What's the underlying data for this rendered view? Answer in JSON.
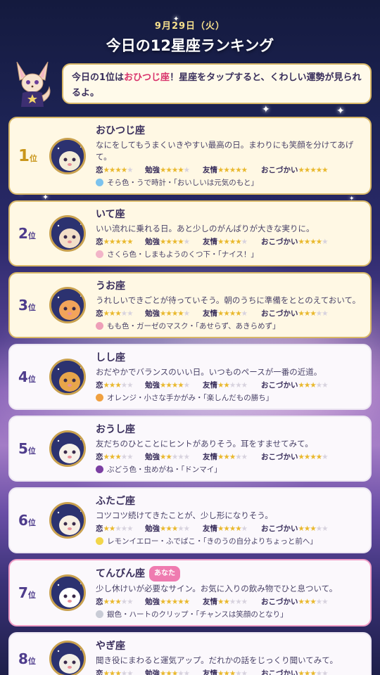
{
  "header": {
    "date": "9月29日（火）",
    "title": "今日の12星座ランキング"
  },
  "bubble": {
    "before": "今日の1位は",
    "highlight": "おひつじ座",
    "after": "！星座をタップすると、くわしい運勢が見られるよ。"
  },
  "labels": {
    "love": "恋",
    "study": "勉強",
    "friend": "友情",
    "money": "おこづかい",
    "rank_suffix": "位"
  },
  "colors": {
    "gold": "#c9961b",
    "star": "#e9b82c",
    "mine_border": "#ef9cc5"
  },
  "cards": [
    {
      "rank": "1",
      "name": "おひつじ座",
      "tag": "",
      "desc": "なにをしてもうまくいきやすい最高の日。まわりにも笑顔を分けてあげて。",
      "love": 4,
      "study": 4,
      "friend": 5,
      "money": 5,
      "lucky": "そら色・うで時計・「おいしいは元気のもと」",
      "dot": "#7cc3ee",
      "icon": "ram-icon"
    },
    {
      "rank": "2",
      "name": "いて座",
      "tag": "",
      "desc": "いい流れに乗れる日。あと少しのがんばりが大きな実りに。",
      "love": 5,
      "study": 4,
      "friend": 4,
      "money": 4,
      "lucky": "さくら色・しまもようのくつ下・「ナイス！」",
      "dot": "#f2b5c8",
      "icon": "archer-icon"
    },
    {
      "rank": "3",
      "name": "うお座",
      "tag": "",
      "desc": "うれしいできごとが待っていそう。朝のうちに準備をととのえておいて。",
      "love": 3,
      "study": 4,
      "friend": 4,
      "money": 3,
      "lucky": "もも色・ガーゼのマスク・「あせらず、あきらめず」",
      "dot": "#ee9fb8",
      "icon": "fish-icon"
    },
    {
      "rank": "4",
      "name": "しし座",
      "tag": "",
      "desc": "おだやかでバランスのいい日。いつものペースが一番の近道。",
      "love": 3,
      "study": 4,
      "friend": 2,
      "money": 3,
      "lucky": "オレンジ・小さな手かがみ・「楽しんだもの勝ち」",
      "dot": "#f0a040",
      "icon": "lion-icon"
    },
    {
      "rank": "5",
      "name": "おうし座",
      "tag": "",
      "desc": "友だちのひとことにヒントがありそう。耳をすませてみて。",
      "love": 3,
      "study": 2,
      "friend": 3,
      "money": 4,
      "lucky": "ぶどう色・虫めがね・「ドンマイ」",
      "dot": "#7b3fa3",
      "icon": "bull-icon"
    },
    {
      "rank": "6",
      "name": "ふたご座",
      "tag": "",
      "desc": "コツコツ続けてきたことが、少し形になりそう。",
      "love": 2,
      "study": 3,
      "friend": 4,
      "money": 3,
      "lucky": "レモンイエロー・ふでばこ・「きのうの自分よりちょっと前へ」",
      "dot": "#f2d64a",
      "icon": "twins-icon"
    },
    {
      "rank": "7",
      "name": "てんびん座",
      "tag": "あなた",
      "desc": "少し休けいが必要なサイン。お気に入りの飲み物でひと息ついて。",
      "love": 3,
      "study": 5,
      "friend": 2,
      "money": 3,
      "lucky": "銀色・ハートのクリップ・「チャンスは笑顔のとなり」",
      "dot": "#c9ccd6",
      "icon": "panda-icon"
    },
    {
      "rank": "8",
      "name": "やぎ座",
      "tag": "",
      "desc": "聞き役にまわると運気アップ。だれかの話をじっくり聞いてみて。",
      "love": 3,
      "study": 3,
      "friend": 3,
      "money": 3,
      "lucky": "",
      "dot": "#c9ccd6",
      "icon": "goat-icon"
    }
  ]
}
